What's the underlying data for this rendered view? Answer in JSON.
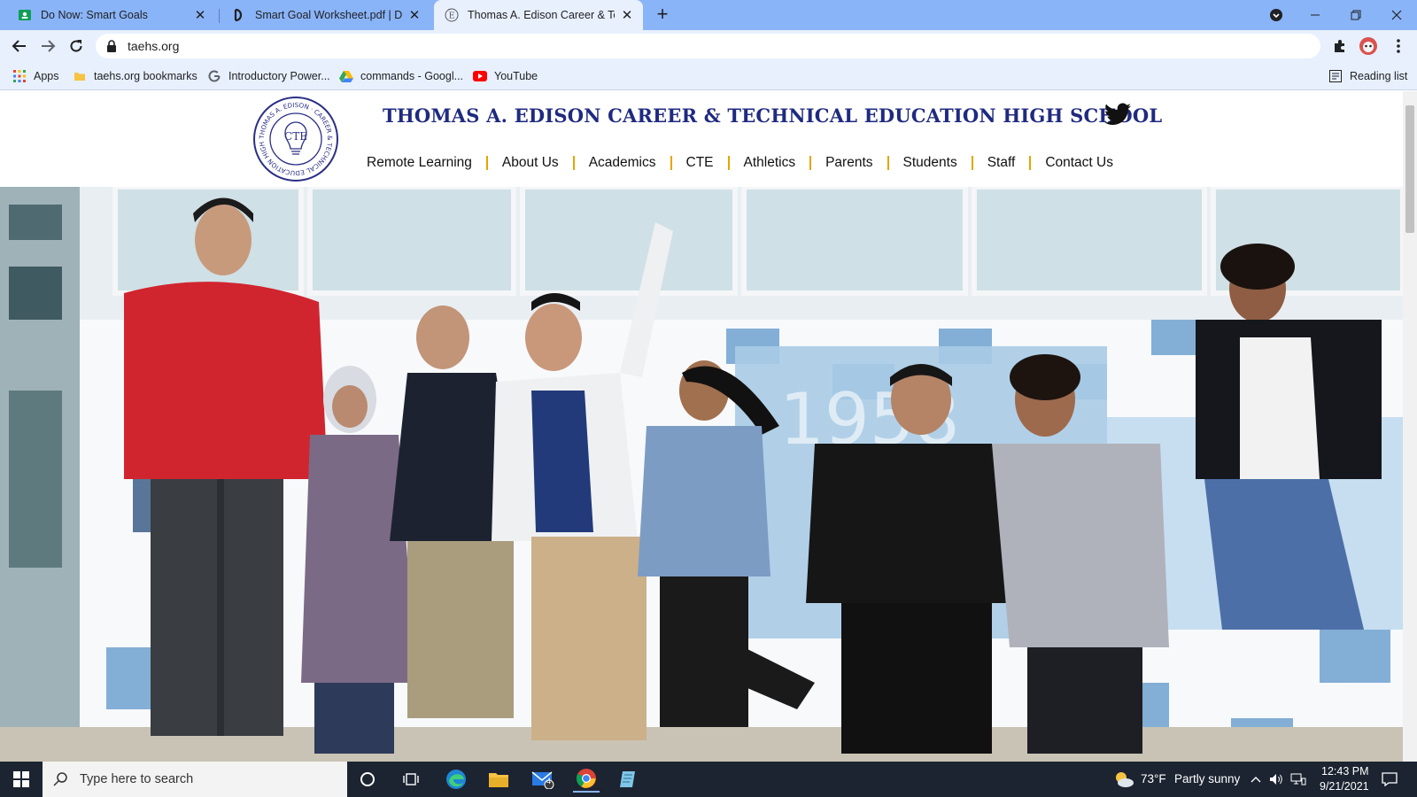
{
  "browser": {
    "tabs": [
      {
        "title": "Do Now: Smart Goals",
        "favicon": "classroom-icon"
      },
      {
        "title": "Smart Goal Worksheet.pdf | Doc...",
        "favicon": "docdrive-icon"
      },
      {
        "title": "Thomas A. Edison Career & Techn...",
        "favicon": "school-icon"
      }
    ],
    "url": "taehs.org",
    "bookmarks": [
      {
        "label": "Apps",
        "icon": "apps-grid-icon"
      },
      {
        "label": "taehs.org bookmarks",
        "icon": "folder-icon"
      },
      {
        "label": "Introductory Power...",
        "icon": "google-icon"
      },
      {
        "label": "commands - Googl...",
        "icon": "drive-icon"
      },
      {
        "label": "YouTube",
        "icon": "youtube-icon"
      }
    ],
    "reading_list": "Reading list"
  },
  "site": {
    "title": "THOMAS A. EDISON CAREER & TECHNICAL EDUCATION HIGH SCHOOL",
    "seal_center": "CTE",
    "seal_ring_text": "THOMAS A. EDISON · CAREER & TECHNICAL EDUCATION HIGH SCHOOL",
    "nav": [
      "Remote Learning",
      "About Us",
      "Academics",
      "CTE",
      "Athletics",
      "Parents",
      "Students",
      "Staff",
      "Contact Us"
    ],
    "hero_wall_number": "1958"
  },
  "taskbar": {
    "search_placeholder": "Type here to search",
    "mail_badge": "4",
    "weather_temp": "73°F",
    "weather_desc": "Partly sunny",
    "time": "12:43 PM",
    "date": "9/21/2021"
  },
  "colors": {
    "tabstrip": "#8ab4f8",
    "toolbar": "#e8f0fe",
    "title_blue": "#1f2a80",
    "nav_separator": "#e8a400",
    "taskbar": "#1c2431"
  }
}
